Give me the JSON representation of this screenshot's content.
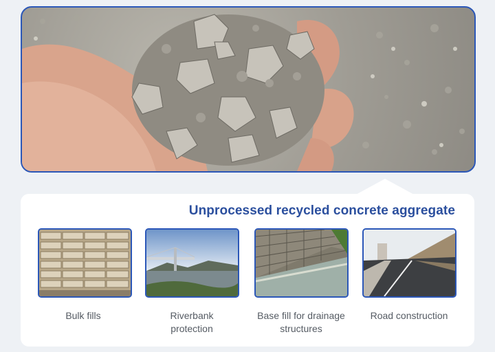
{
  "headline": "Unprocessed recycled concrete aggregate",
  "applications": [
    {
      "label": "Bulk fills",
      "icon": "cement-bags-photo"
    },
    {
      "label": "Riverbank protection",
      "icon": "river-bridge-photo"
    },
    {
      "label": "Base fill for drainage structures",
      "icon": "gabion-wall-photo"
    },
    {
      "label": "Road construction",
      "icon": "road-photo"
    }
  ],
  "colors": {
    "accent": "#2b57b8",
    "headline": "#2b4f9e",
    "caption": "#555b63"
  }
}
